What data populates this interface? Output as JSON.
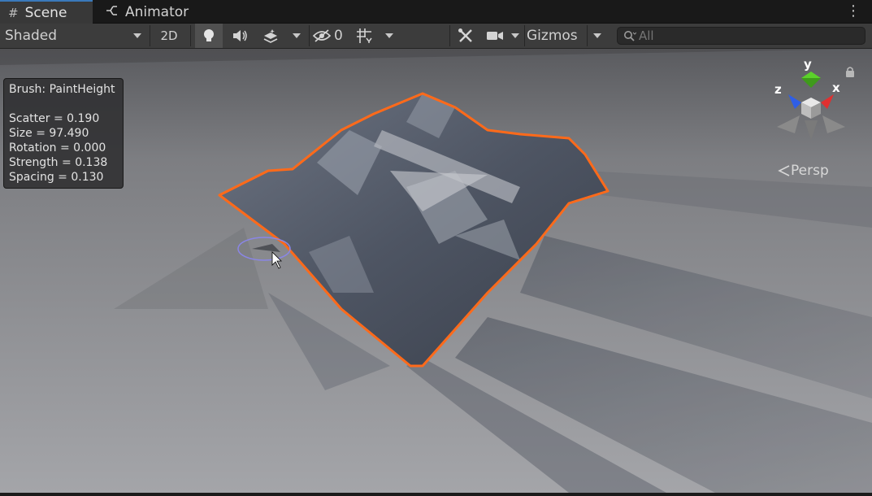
{
  "tabs": [
    {
      "label": "Scene",
      "icon": "hash-icon",
      "active": true
    },
    {
      "label": "Animator",
      "icon": "animator-icon",
      "active": false
    }
  ],
  "toolbar": {
    "shading_mode": "Shaded",
    "two_d_label": "2D",
    "hidden_count": "0",
    "gizmos_label": "Gizmos",
    "search_placeholder": "All"
  },
  "brush": {
    "title": "Brush: PaintHeight",
    "scatter": "Scatter = 0.190",
    "size": "Size = 97.490",
    "rotation": "Rotation = 0.000",
    "strength": "Strength = 0.138",
    "spacing": "Spacing = 0.130"
  },
  "gizmo": {
    "x_label": "x",
    "y_label": "y",
    "z_label": "z",
    "projection": "Persp"
  },
  "colors": {
    "selection_outline": "#ff6a1a",
    "tab_accent": "#3a79bb",
    "axis_x": "#e03030",
    "axis_y": "#5bd12a",
    "axis_z": "#2f5ee6",
    "brush_preview": "#8a86e6"
  }
}
